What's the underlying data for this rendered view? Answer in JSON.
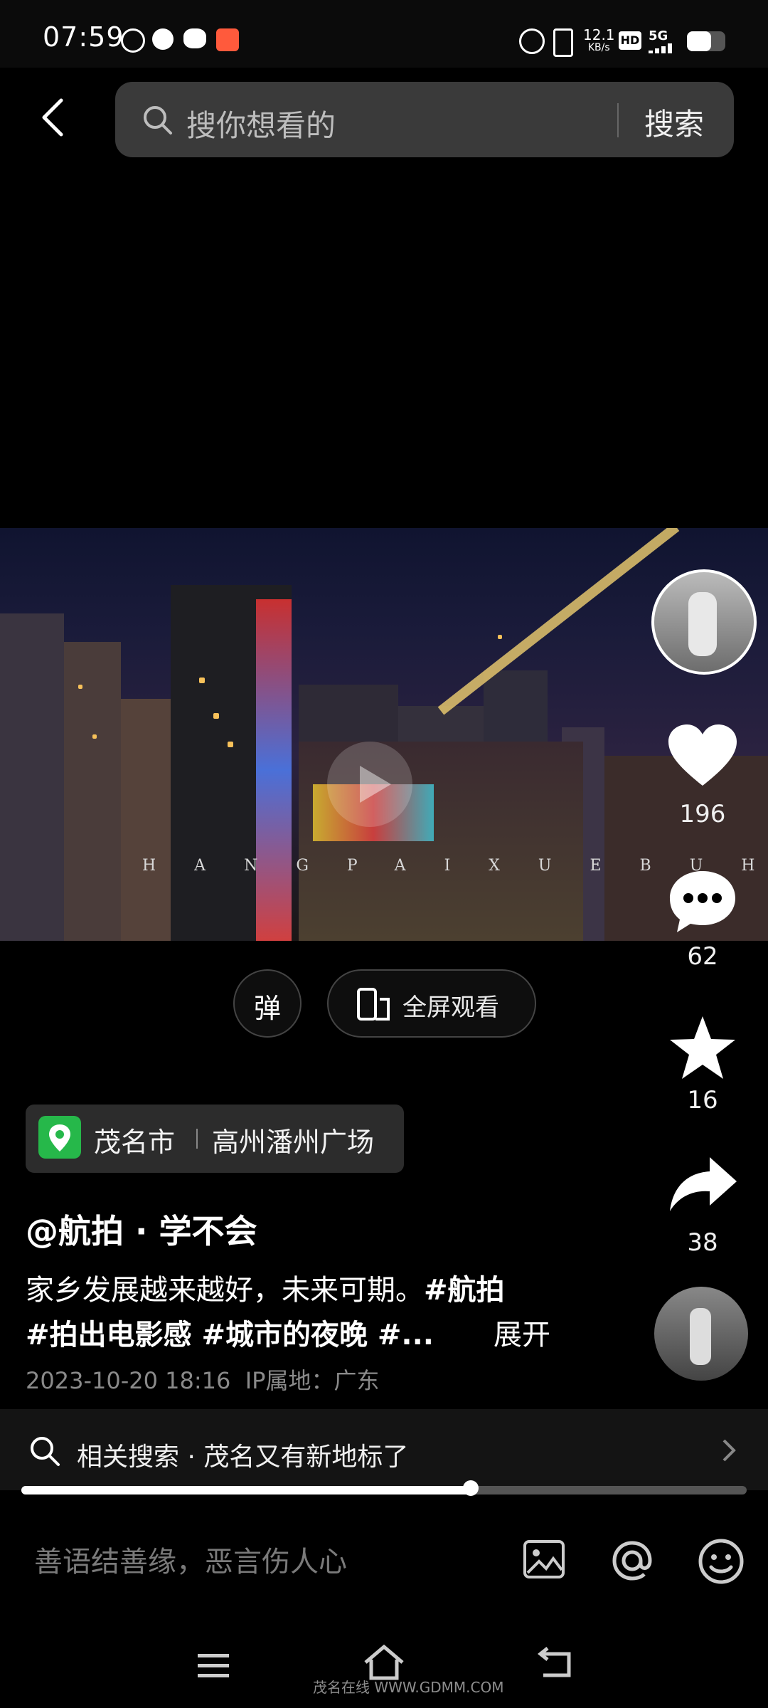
{
  "status_bar": {
    "time": "07:59",
    "net_speed": "12.1",
    "net_unit": "KB/s",
    "hd": "HD",
    "network": "5G"
  },
  "search": {
    "placeholder": "搜你想看的",
    "button": "搜索"
  },
  "video": {
    "watermark": "HANGPAIXUEBUHUI"
  },
  "rail": {
    "likes": "196",
    "comments": "62",
    "favorites": "16",
    "shares": "38"
  },
  "controls": {
    "danmaku": "弹",
    "fullscreen": "全屏观看"
  },
  "location": {
    "city": "茂名市",
    "place": "高州潘州广场"
  },
  "post": {
    "author": "@航拍 · 学不会",
    "line1_text": "家乡发展越来越好，未来可期。",
    "line1_tag": "#航拍",
    "line2_tags": "#拍出电影感 #城市的夜晚 #...",
    "expand": "展开",
    "date": "2023-10-20 18:16",
    "ip": "IP属地：广东"
  },
  "related": {
    "text": "相关搜索 · 茂名又有新地标了"
  },
  "progress": 0.62,
  "comment": {
    "placeholder": "善语结善缘，恶言伤人心"
  },
  "watermark_brand": "茂名在线 WWW.GDMM.COM",
  "colors": {
    "accent_green": "#26b84a",
    "background": "#000000"
  }
}
